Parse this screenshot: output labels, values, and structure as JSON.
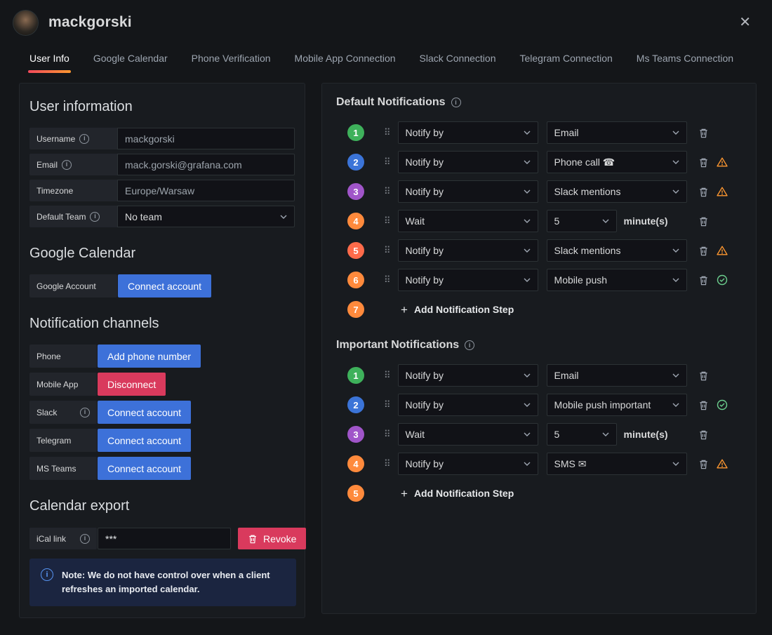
{
  "header": {
    "title": "mackgorski"
  },
  "icons": {
    "close": "✕",
    "drag": "⠿",
    "plus": "+"
  },
  "colors": {
    "primary_blue": "#3d71d9",
    "danger_red": "#d93a5d",
    "tab_accent_orange": "#ff9830",
    "warning_orange": "#ff9830",
    "success_green": "#6ccf8e",
    "panel_bg": "#181b1f",
    "page_bg": "#141619"
  },
  "tabs": [
    {
      "label": "User Info"
    },
    {
      "label": "Google Calendar"
    },
    {
      "label": "Phone Verification"
    },
    {
      "label": "Mobile App Connection"
    },
    {
      "label": "Slack Connection"
    },
    {
      "label": "Telegram Connection"
    },
    {
      "label": "Ms Teams Connection"
    }
  ],
  "user_info": {
    "heading": "User information",
    "username": {
      "label": "Username",
      "value": "mackgorski"
    },
    "email": {
      "label": "Email",
      "value": "mack.gorski@grafana.com"
    },
    "timezone": {
      "label": "Timezone",
      "value": "Europe/Warsaw"
    },
    "team": {
      "label": "Default Team",
      "value": "No team"
    }
  },
  "google_calendar": {
    "heading": "Google Calendar",
    "account_label": "Google Account",
    "connect_button": "Connect account"
  },
  "channels": {
    "heading": "Notification channels",
    "rows": [
      {
        "label": "Phone",
        "button": "Add phone number",
        "style": "primary"
      },
      {
        "label": "Mobile App",
        "button": "Disconnect",
        "style": "danger"
      },
      {
        "label": "Slack",
        "button": "Connect account",
        "style": "primary"
      },
      {
        "label": "Telegram",
        "button": "Connect account",
        "style": "primary"
      },
      {
        "label": "MS Teams",
        "button": "Connect account",
        "style": "primary"
      }
    ]
  },
  "calendar_export": {
    "heading": "Calendar export",
    "ical_label": "iCal link",
    "ical_value": "***",
    "revoke_button": "Revoke",
    "note": "Note: We do not have control over when a client refreshes an imported calendar."
  },
  "default_notifications": {
    "heading": "Default Notifications",
    "steps": [
      {
        "num": "1",
        "color": "#3eb15b",
        "type_label": "Notify by",
        "value_label": "Email",
        "status": "none"
      },
      {
        "num": "2",
        "color": "#3b74d8",
        "type_label": "Notify by",
        "value_label": "Phone call ☎",
        "status": "warning"
      },
      {
        "num": "3",
        "color": "#a055c9",
        "type_label": "Notify by",
        "value_label": "Slack mentions",
        "status": "warning"
      },
      {
        "num": "4",
        "color": "#ff8a3c",
        "type_label": "Wait",
        "value_label": "5",
        "suffix": "minute(s)",
        "status": "none"
      },
      {
        "num": "5",
        "color": "#ff6b4a",
        "type_label": "Notify by",
        "value_label": "Slack mentions",
        "status": "warning"
      },
      {
        "num": "6",
        "color": "#ff8a3c",
        "type_label": "Notify by",
        "value_label": "Mobile push",
        "status": "ok"
      }
    ],
    "add_step": {
      "num": "7",
      "color": "#ff8a3c",
      "label": "Add Notification Step"
    }
  },
  "important_notifications": {
    "heading": "Important Notifications",
    "steps": [
      {
        "num": "1",
        "color": "#3eb15b",
        "type_label": "Notify by",
        "value_label": "Email",
        "status": "none"
      },
      {
        "num": "2",
        "color": "#3b74d8",
        "type_label": "Notify by",
        "value_label": "Mobile push important",
        "status": "ok"
      },
      {
        "num": "3",
        "color": "#a055c9",
        "type_label": "Wait",
        "value_label": "5",
        "suffix": "minute(s)",
        "status": "none"
      },
      {
        "num": "4",
        "color": "#ff8a3c",
        "type_label": "Notify by",
        "value_label": "SMS ✉",
        "status": "warning"
      }
    ],
    "add_step": {
      "num": "5",
      "color": "#ff8a3c",
      "label": "Add Notification Step"
    }
  }
}
